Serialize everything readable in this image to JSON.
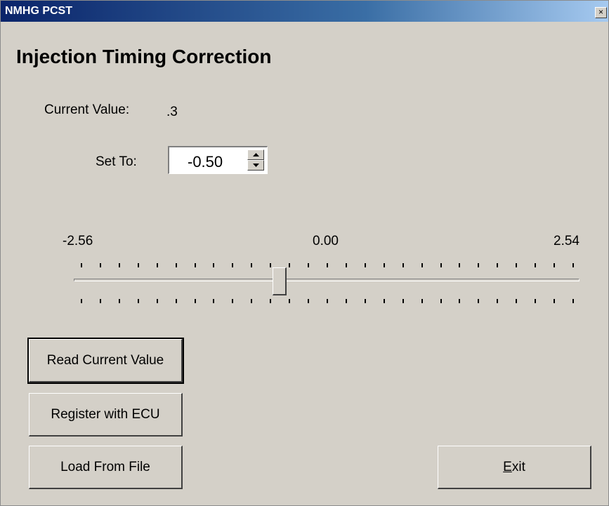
{
  "window": {
    "title": "NMHG PCST",
    "close_glyph": "×"
  },
  "heading": "Injection Timing Correction",
  "current": {
    "label": "Current Value:",
    "value": ".3"
  },
  "set_to": {
    "label": "Set To:",
    "value": "-0.50"
  },
  "slider": {
    "min_label": "-2.56",
    "mid_label": "0.00",
    "max_label": "2.54",
    "min": -2.56,
    "max": 2.54,
    "value": -0.5
  },
  "buttons": {
    "read": "Read Current Value",
    "register": "Register with ECU",
    "load": "Load From File",
    "exit": "Exit"
  }
}
